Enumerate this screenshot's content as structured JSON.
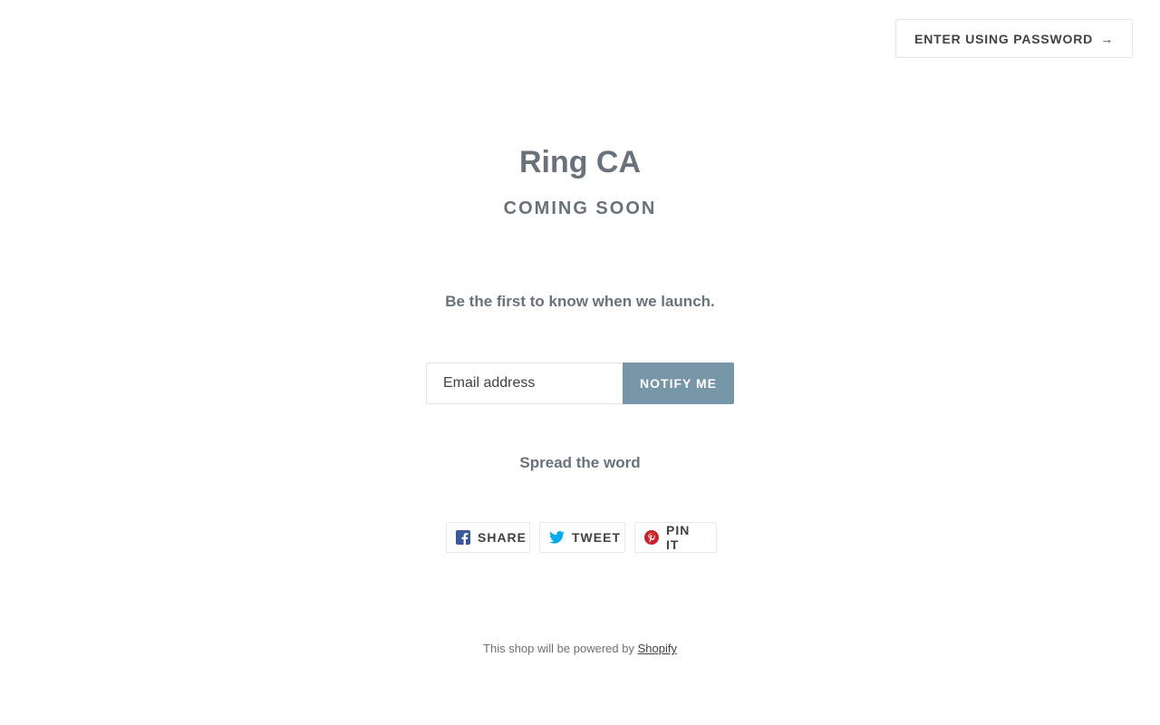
{
  "header": {
    "password_button_label": "ENTER USING PASSWORD",
    "password_button_arrow": "→"
  },
  "main": {
    "store_name": "Ring CA",
    "status": "COMING SOON",
    "message": "Be the first to know when we launch.",
    "signup": {
      "email_placeholder": "Email address",
      "email_value": "",
      "submit_label": "NOTIFY ME"
    },
    "share_heading": "Spread the word",
    "share_buttons": [
      {
        "label": "SHARE",
        "icon": "facebook-icon",
        "color": "#3b5998"
      },
      {
        "label": "TWEET",
        "icon": "twitter-icon",
        "color": "#00aced"
      },
      {
        "label": "PIN IT",
        "icon": "pinterest-icon",
        "color": "#cb2027"
      }
    ]
  },
  "footer": {
    "text": "This shop will be powered by",
    "link_label": "Shopify"
  },
  "colors": {
    "text": "#69727b",
    "button_accent": "#7796a8",
    "dark_text": "#3d4246"
  }
}
